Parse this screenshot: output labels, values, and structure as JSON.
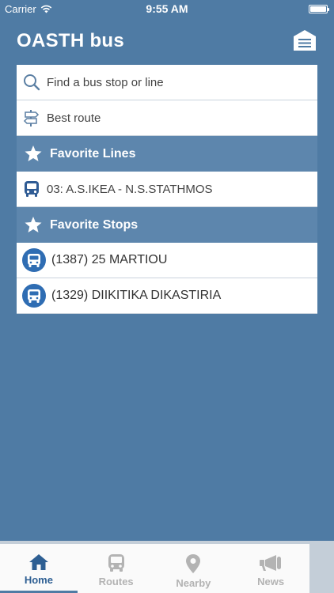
{
  "status_bar": {
    "carrier": "Carrier",
    "time": "9:55 AM"
  },
  "header": {
    "title": "OASTH bus",
    "menu_icon": "menu-icon"
  },
  "search": {
    "find_label": "Find a bus stop or line",
    "best_route_label": "Best route"
  },
  "favorite_lines": {
    "title": "Favorite Lines",
    "items": [
      {
        "label": "03: A.S.IKEA - N.S.STATHMOS"
      }
    ]
  },
  "favorite_stops": {
    "title": "Favorite Stops",
    "items": [
      {
        "label": "(1387) 25 MARTIOU"
      },
      {
        "label": "(1329) DIIKITIKA DIKASTIRIA"
      }
    ]
  },
  "tabs": [
    {
      "label": "Home",
      "icon": "home-icon",
      "active": true
    },
    {
      "label": "Routes",
      "icon": "bus-icon",
      "active": false
    },
    {
      "label": "Nearby",
      "icon": "location-pin-icon",
      "active": false
    },
    {
      "label": "News",
      "icon": "megaphone-icon",
      "active": false
    }
  ],
  "colors": {
    "background": "#4f7ba4",
    "section": "#5d86ad",
    "accent": "#2f6db3",
    "active_tab": "#2e5f93"
  }
}
